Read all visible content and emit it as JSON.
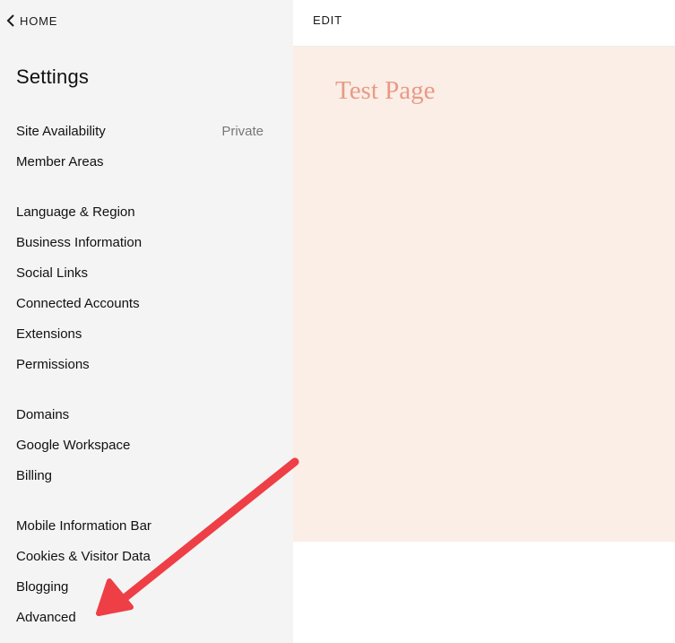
{
  "nav": {
    "home_label": "HOME"
  },
  "sidebar": {
    "title": "Settings",
    "items": [
      {
        "label": "Site Availability",
        "value": "Private"
      },
      {
        "label": "Member Areas"
      },
      {
        "label": "Language & Region"
      },
      {
        "label": "Business Information"
      },
      {
        "label": "Social Links"
      },
      {
        "label": "Connected Accounts"
      },
      {
        "label": "Extensions"
      },
      {
        "label": "Permissions"
      },
      {
        "label": "Domains"
      },
      {
        "label": "Google Workspace"
      },
      {
        "label": "Billing"
      },
      {
        "label": "Mobile Information Bar"
      },
      {
        "label": "Cookies & Visitor Data"
      },
      {
        "label": "Blogging"
      },
      {
        "label": "Advanced"
      }
    ]
  },
  "toolbar": {
    "edit_label": "EDIT"
  },
  "preview": {
    "page_title": "Test Page"
  },
  "colors": {
    "sidebar_bg": "#f4f4f4",
    "preview_bg": "#fbeee6",
    "preview_title": "#e89a86",
    "annotation_arrow": "#ee3e46"
  },
  "icons": {
    "back": "chevron-left-icon",
    "annotation": "red-arrow-icon"
  }
}
